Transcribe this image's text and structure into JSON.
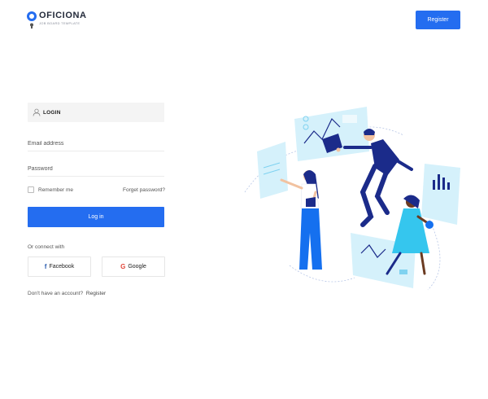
{
  "brand": {
    "name": "OFICIONA",
    "tagline": "JOB BOARD TEMPLATE"
  },
  "header": {
    "register_label": "Register"
  },
  "login": {
    "title": "LOGIN",
    "email_placeholder": "Email address",
    "password_placeholder": "Password",
    "remember_label": "Remember me",
    "forget_label": "Forget password?",
    "submit_label": "Log in",
    "or_connect": "Or connect with",
    "facebook_label": "Facebook",
    "google_label": "Google",
    "no_account_text": "Don't have an account?",
    "register_link": "Register"
  },
  "icons": {
    "user": "user-icon",
    "facebook": "facebook-icon",
    "google": "google-icon",
    "logo": "brand-ring-icon"
  },
  "colors": {
    "accent": "#246df0",
    "illustration_light": "#d5f1fb",
    "illustration_dark": "#1b2b8a"
  }
}
